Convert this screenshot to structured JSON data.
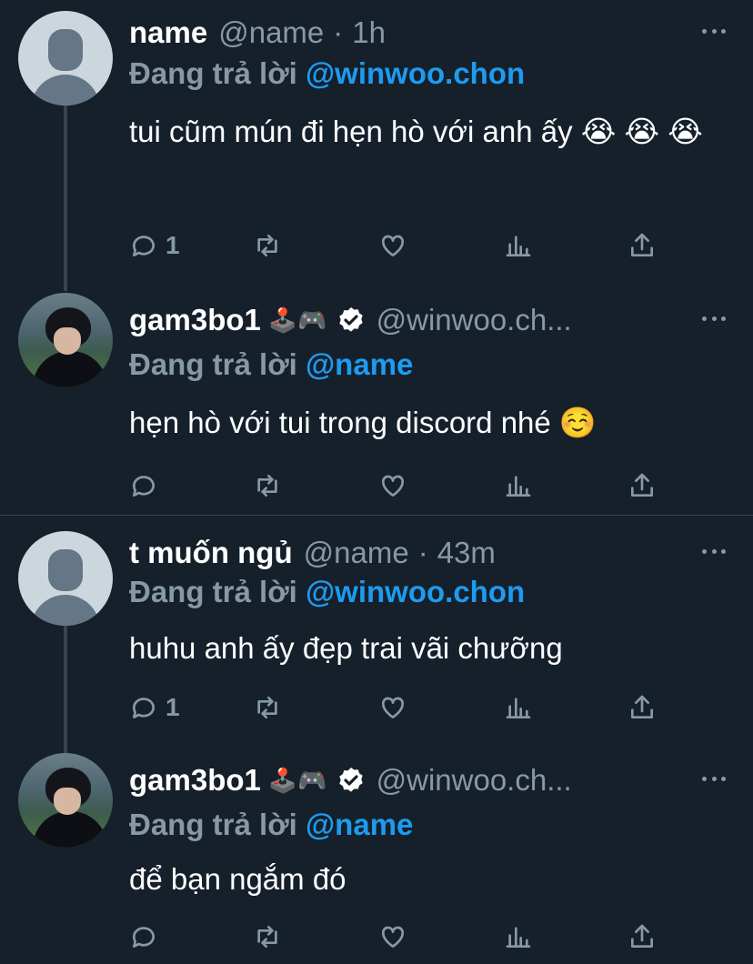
{
  "tweets": [
    {
      "name": "name",
      "handle": "@name",
      "dot": "·",
      "time": "1h",
      "replying_prefix": "Đang trả lời",
      "replying_to": "@winwoo.chon",
      "text": "tui cũm mún đi hẹn hò với anh ấy 😭 😭 😭",
      "reply_count": "1",
      "avatar": "default-avatar-icon"
    },
    {
      "name": "gam3bo1",
      "emojis": "🕹️🎮",
      "handle": "@winwoo.ch...",
      "replying_prefix": "Đang trả lời",
      "replying_to": "@name",
      "text": "hẹn hò với tui trong discord nhé ☺️",
      "reply_count": "",
      "avatar": "profile-photo"
    },
    {
      "name": "t muốn ngủ",
      "handle": "@name",
      "dot": "·",
      "time": "43m",
      "replying_prefix": "Đang trả lời",
      "replying_to": "@winwoo.chon",
      "text": "huhu anh ấy đẹp trai vãi chưỡng",
      "reply_count": "1",
      "avatar": "default-avatar-icon"
    },
    {
      "name": "gam3bo1",
      "emojis": "🕹️🎮",
      "handle": "@winwoo.ch...",
      "replying_prefix": "Đang trả lời",
      "replying_to": "@name",
      "text": "để bạn ngắm đó",
      "reply_count": "",
      "avatar": "profile-photo"
    }
  ],
  "icons": [
    "reply-icon",
    "retweet-icon",
    "like-icon",
    "analytics-icon",
    "share-icon",
    "more-icon",
    "verified-badge-icon"
  ],
  "colors": {
    "background": "#15202b",
    "secondary_text": "#8899a6",
    "mention": "#1d9bf0",
    "verified": "#ffffff"
  }
}
